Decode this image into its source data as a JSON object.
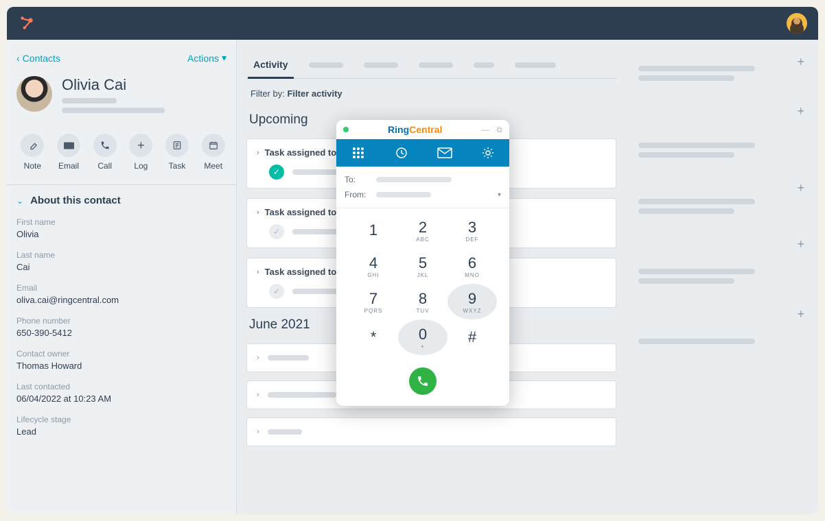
{
  "header": {
    "breadcrumb": "Contacts",
    "actions_label": "Actions"
  },
  "contact": {
    "name": "Olivia Cai"
  },
  "action_buttons": [
    {
      "label": "Note"
    },
    {
      "label": "Email"
    },
    {
      "label": "Call"
    },
    {
      "label": "Log"
    },
    {
      "label": "Task"
    },
    {
      "label": "Meet"
    }
  ],
  "about_section": {
    "title": "About this contact",
    "fields": [
      {
        "label": "First name",
        "value": "Olivia"
      },
      {
        "label": "Last name",
        "value": "Cai"
      },
      {
        "label": "Email",
        "value": "oliva.cai@ringcentral.com"
      },
      {
        "label": "Phone number",
        "value": "650-390-5412"
      },
      {
        "label": "Contact owner",
        "value": "Thomas Howard"
      },
      {
        "label": "Last contacted",
        "value": "06/04/2022 at 10:23 AM"
      },
      {
        "label": "Lifecycle stage",
        "value": "Lead"
      }
    ]
  },
  "tabs": {
    "active": "Activity"
  },
  "filter": {
    "label": "Filter by:",
    "value": "Filter activity"
  },
  "upcoming": {
    "heading": "Upcoming",
    "tasks": [
      {
        "title": "Task assigned to",
        "done": true
      },
      {
        "title": "Task assigned to",
        "done": false
      },
      {
        "title": "Task assigned to",
        "done": false
      }
    ]
  },
  "history": {
    "heading": "June 2021"
  },
  "dialer": {
    "brand_a": "Ring",
    "brand_b": "Central",
    "fields": {
      "to_label": "To:",
      "from_label": "From:"
    },
    "keys": [
      {
        "num": "1",
        "sub": ""
      },
      {
        "num": "2",
        "sub": "ABC"
      },
      {
        "num": "3",
        "sub": "DEF"
      },
      {
        "num": "4",
        "sub": "GHI"
      },
      {
        "num": "5",
        "sub": "JKL"
      },
      {
        "num": "6",
        "sub": "MNO"
      },
      {
        "num": "7",
        "sub": "PQRS"
      },
      {
        "num": "8",
        "sub": "TUV"
      },
      {
        "num": "9",
        "sub": "WXYZ",
        "hover": true
      },
      {
        "num": "*",
        "sub": ""
      },
      {
        "num": "0",
        "sub": "+",
        "hover": true
      },
      {
        "num": "#",
        "sub": ""
      }
    ]
  }
}
